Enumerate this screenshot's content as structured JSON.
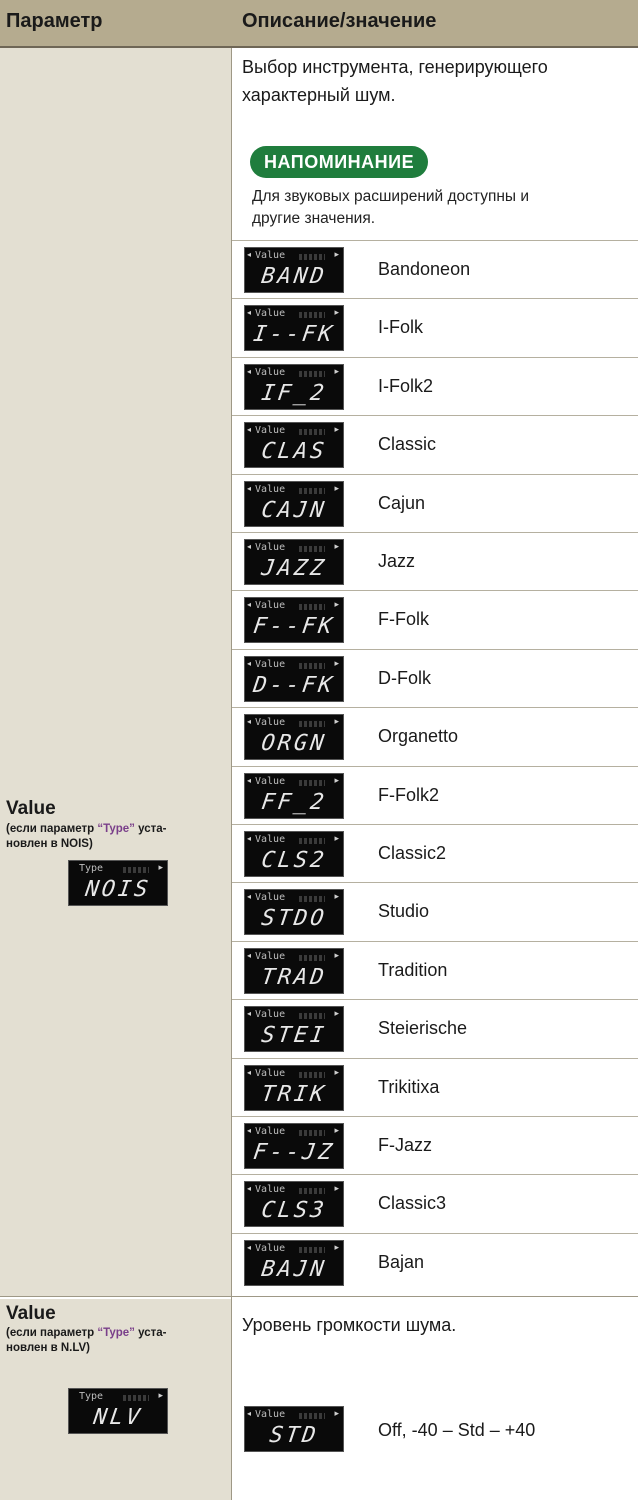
{
  "header": {
    "col1": "Параметр",
    "col2": "Описание/значение"
  },
  "noise": {
    "param": {
      "name": "Value",
      "cond_pre": "(если параметр ",
      "cond_type": "“Type”",
      "cond_post": " уста-",
      "cond_line2": "новлен в NOIS)",
      "display": {
        "label": "Type",
        "code": "NOIS"
      }
    },
    "desc_line1": "Выбор инструмента, генерирующего",
    "desc_line2": "характерный шум.",
    "reminder_label": "НАПОМИНАНИЕ",
    "note_line1": "Для звуковых расширений доступны и",
    "note_line2": "другие значения.",
    "items": [
      {
        "lcd_label": "Value",
        "code": "BAND",
        "name": "Bandoneon"
      },
      {
        "lcd_label": "Value",
        "code": "I--FK",
        "name": "I-Folk"
      },
      {
        "lcd_label": "Value",
        "code": "IF_2",
        "name": "I-Folk2"
      },
      {
        "lcd_label": "Value",
        "code": "CLAS",
        "name": "Classic"
      },
      {
        "lcd_label": "Value",
        "code": "CAJN",
        "name": "Cajun"
      },
      {
        "lcd_label": "Value",
        "code": "JAZZ",
        "name": "Jazz"
      },
      {
        "lcd_label": "Value",
        "code": "F--FK",
        "name": "F-Folk"
      },
      {
        "lcd_label": "Value",
        "code": "D--FK",
        "name": "D-Folk"
      },
      {
        "lcd_label": "Value",
        "code": "ORGN",
        "name": "Organetto"
      },
      {
        "lcd_label": "Value",
        "code": "FF_2",
        "name": "F-Folk2"
      },
      {
        "lcd_label": "Value",
        "code": "CLS2",
        "name": "Classic2"
      },
      {
        "lcd_label": "Value",
        "code": "STDO",
        "name": "Studio"
      },
      {
        "lcd_label": "Value",
        "code": "TRAD",
        "name": "Tradition"
      },
      {
        "lcd_label": "Value",
        "code": "STEI",
        "name": "Steierische"
      },
      {
        "lcd_label": "Value",
        "code": "TRIK",
        "name": "Trikitixa"
      },
      {
        "lcd_label": "Value",
        "code": "F--JZ",
        "name": "F-Jazz"
      },
      {
        "lcd_label": "Value",
        "code": "CLS3",
        "name": "Classic3"
      },
      {
        "lcd_label": "Value",
        "code": "BAJN",
        "name": "Bajan"
      }
    ]
  },
  "level": {
    "param": {
      "name": "Value",
      "cond_pre": "(если параметр ",
      "cond_type": "“Type”",
      "cond_post": " уста-",
      "cond_line2": "новлен в N.LV)",
      "display": {
        "label": "Type",
        "code": "NLV"
      }
    },
    "desc": "Уровень громкости шума.",
    "item": {
      "lcd_label": "Value",
      "code": "STD",
      "name": "Off,  -40 – Std – +40"
    }
  }
}
